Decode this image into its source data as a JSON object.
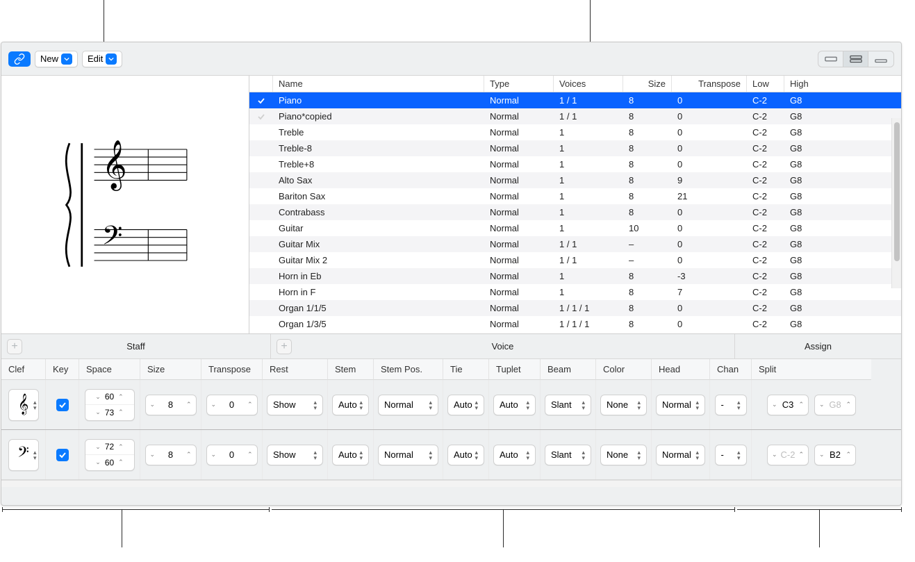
{
  "toolbar": {
    "new_label": "New",
    "edit_label": "Edit"
  },
  "columns": {
    "name": "Name",
    "type": "Type",
    "voices": "Voices",
    "size": "Size",
    "transpose": "Transpose",
    "low": "Low",
    "high": "High"
  },
  "styles": [
    {
      "check": true,
      "name": "Piano",
      "type": "Normal",
      "voices": "1 / 1",
      "size": "8",
      "transpose": "0",
      "low": "C-2",
      "high": "G8",
      "selected": true
    },
    {
      "check": "dim",
      "name": "Piano*copied",
      "type": "Normal",
      "voices": "1 / 1",
      "size": "8",
      "transpose": "0",
      "low": "C-2",
      "high": "G8"
    },
    {
      "name": "Treble",
      "type": "Normal",
      "voices": "1",
      "size": "8",
      "transpose": "0",
      "low": "C-2",
      "high": "G8"
    },
    {
      "name": "Treble-8",
      "type": "Normal",
      "voices": "1",
      "size": "8",
      "transpose": "0",
      "low": "C-2",
      "high": "G8"
    },
    {
      "name": "Treble+8",
      "type": "Normal",
      "voices": "1",
      "size": "8",
      "transpose": "0",
      "low": "C-2",
      "high": "G8"
    },
    {
      "name": "Alto Sax",
      "type": "Normal",
      "voices": "1",
      "size": "8",
      "transpose": "9",
      "low": "C-2",
      "high": "G8"
    },
    {
      "name": "Bariton Sax",
      "type": "Normal",
      "voices": "1",
      "size": "8",
      "transpose": "21",
      "low": "C-2",
      "high": "G8"
    },
    {
      "name": "Contrabass",
      "type": "Normal",
      "voices": "1",
      "size": "8",
      "transpose": "0",
      "low": "C-2",
      "high": "G8"
    },
    {
      "name": "Guitar",
      "type": "Normal",
      "voices": "1",
      "size": "10",
      "transpose": "0",
      "low": "C-2",
      "high": "G8"
    },
    {
      "name": "Guitar Mix",
      "type": "Normal",
      "voices": "1 / 1",
      "size": "–",
      "transpose": "0",
      "low": "C-2",
      "high": "G8"
    },
    {
      "name": "Guitar Mix 2",
      "type": "Normal",
      "voices": "1 / 1",
      "size": "–",
      "transpose": "0",
      "low": "C-2",
      "high": "G8"
    },
    {
      "name": "Horn in Eb",
      "type": "Normal",
      "voices": "1",
      "size": "8",
      "transpose": "-3",
      "low": "C-2",
      "high": "G8"
    },
    {
      "name": "Horn in F",
      "type": "Normal",
      "voices": "1",
      "size": "8",
      "transpose": "7",
      "low": "C-2",
      "high": "G8"
    },
    {
      "name": "Organ 1/1/5",
      "type": "Normal",
      "voices": "1 / 1 / 1",
      "size": "8",
      "transpose": "0",
      "low": "C-2",
      "high": "G8"
    },
    {
      "name": "Organ 1/3/5",
      "type": "Normal",
      "voices": "1 / 1 / 1",
      "size": "8",
      "transpose": "0",
      "low": "C-2",
      "high": "G8"
    }
  ],
  "panels": {
    "staff_label": "Staff",
    "voice_label": "Voice",
    "assign_label": "Assign",
    "headers": {
      "clef": "Clef",
      "key": "Key",
      "space": "Space",
      "size": "Size",
      "transpose": "Transpose",
      "rest": "Rest",
      "stem": "Stem",
      "stempos": "Stem Pos.",
      "tie": "Tie",
      "tuplet": "Tuplet",
      "beam": "Beam",
      "color": "Color",
      "head": "Head",
      "chan": "Chan",
      "split": "Split"
    }
  },
  "staff_rows": [
    {
      "clef": "treble",
      "key": true,
      "space_top": "60",
      "space_bottom": "73",
      "size": "8",
      "transpose": "0",
      "rest": "Show",
      "stem": "Auto",
      "stempos": "Normal",
      "tie": "Auto",
      "tuplet": "Auto",
      "beam": "Slant",
      "color": "None",
      "head": "Normal",
      "chan": "-",
      "split_a": "C3",
      "split_b": "G8",
      "split_b_dim": true
    },
    {
      "clef": "bass",
      "key": true,
      "space_top": "72",
      "space_bottom": "60",
      "size": "8",
      "transpose": "0",
      "rest": "Show",
      "stem": "Auto",
      "stempos": "Normal",
      "tie": "Auto",
      "tuplet": "Auto",
      "beam": "Slant",
      "color": "None",
      "head": "Normal",
      "chan": "-",
      "split_a": "C-2",
      "split_a_dim": true,
      "split_b": "B2"
    }
  ]
}
